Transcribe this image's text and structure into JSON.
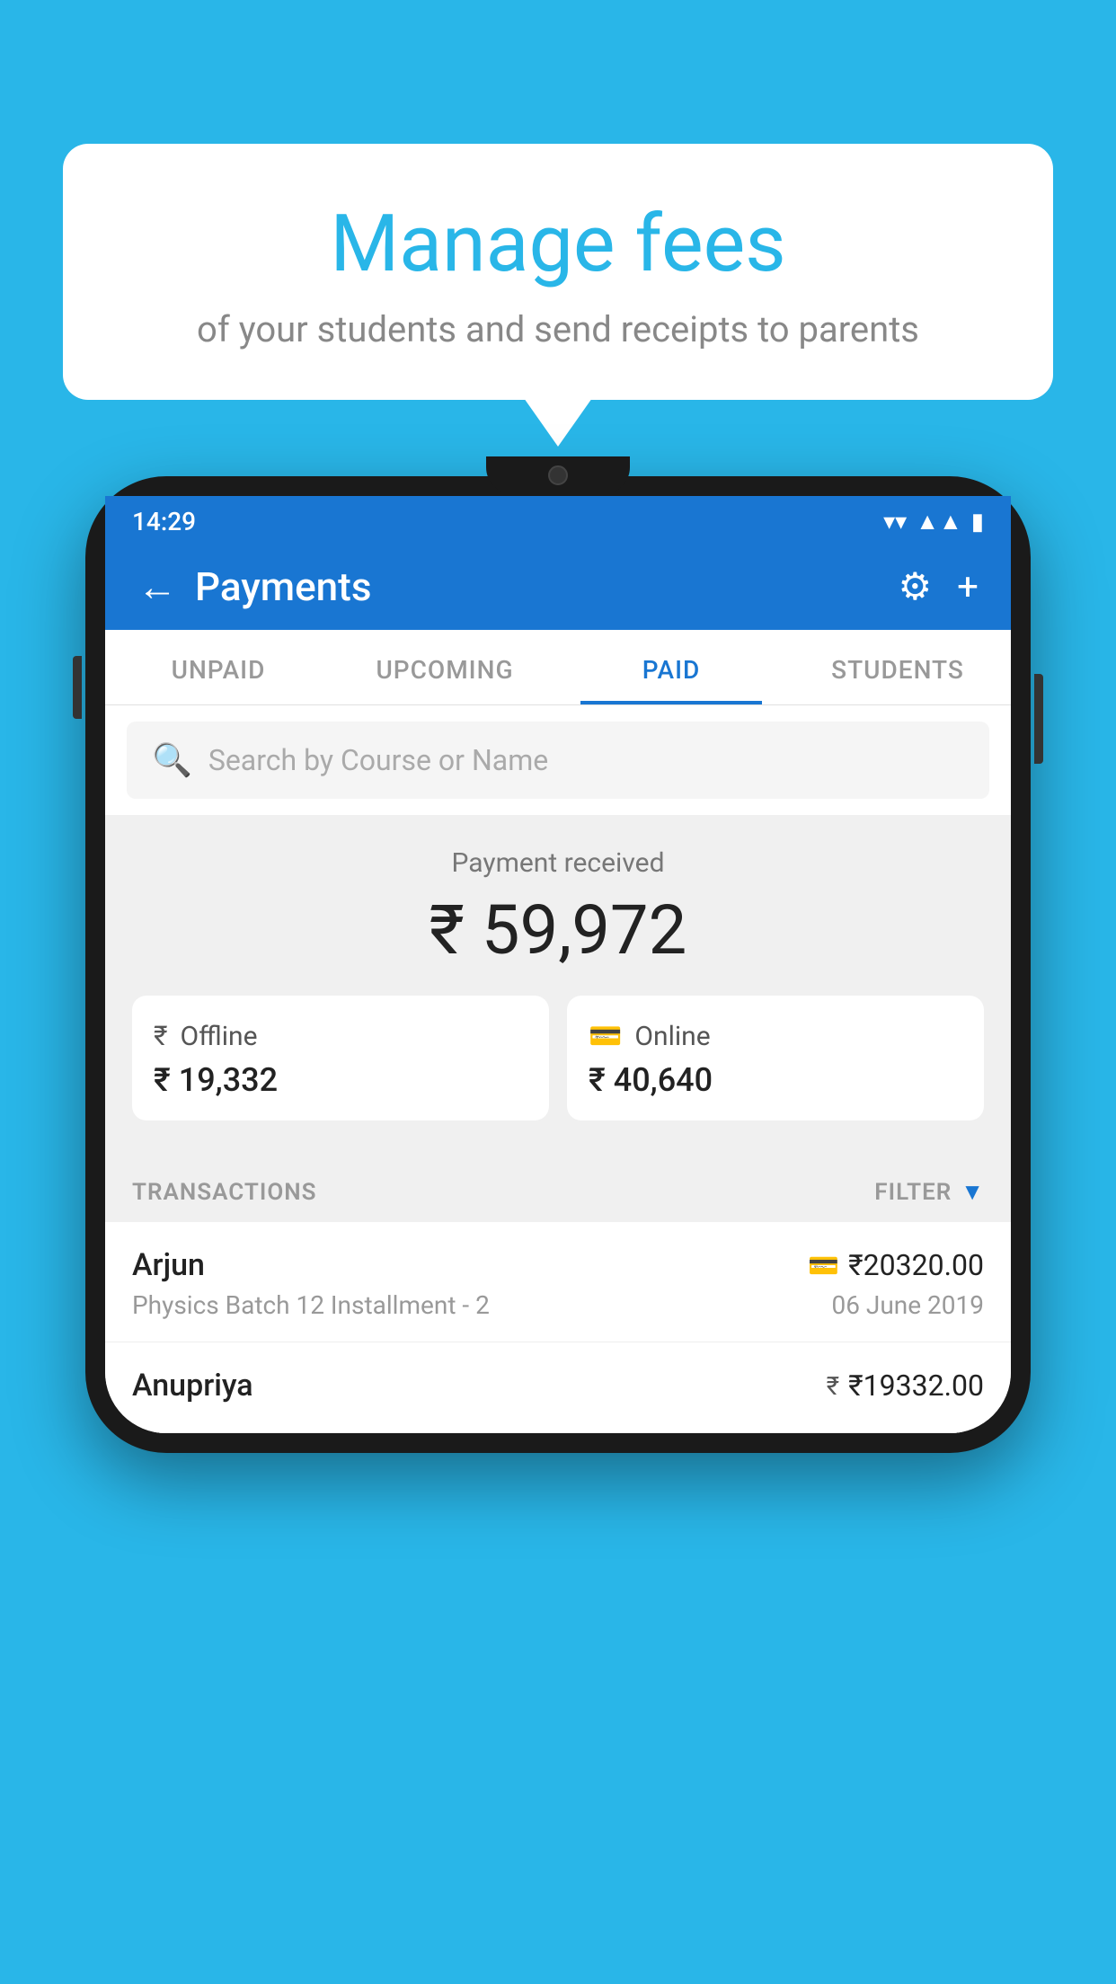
{
  "background_color": "#29b6e8",
  "bubble": {
    "title": "Manage fees",
    "subtitle": "of your students and send receipts to parents"
  },
  "phone": {
    "status_bar": {
      "time": "14:29",
      "wifi": "▼",
      "signal": "▲",
      "battery": "▮"
    },
    "app_bar": {
      "back_label": "←",
      "title": "Payments",
      "gear_label": "⚙",
      "plus_label": "+"
    },
    "tabs": [
      {
        "label": "UNPAID",
        "active": false
      },
      {
        "label": "UPCOMING",
        "active": false
      },
      {
        "label": "PAID",
        "active": true
      },
      {
        "label": "STUDENTS",
        "active": false
      }
    ],
    "search": {
      "placeholder": "Search by Course or Name"
    },
    "payment_summary": {
      "label": "Payment received",
      "amount": "₹ 59,972",
      "offline": {
        "type": "Offline",
        "amount": "₹ 19,332"
      },
      "online": {
        "type": "Online",
        "amount": "₹ 40,640"
      }
    },
    "transactions": {
      "header": "TRANSACTIONS",
      "filter_label": "FILTER",
      "rows": [
        {
          "name": "Arjun",
          "course": "Physics Batch 12 Installment - 2",
          "amount": "₹20320.00",
          "date": "06 June 2019",
          "payment_icon": "card"
        },
        {
          "name": "Anupriya",
          "course": "",
          "amount": "₹19332.00",
          "date": "",
          "payment_icon": "cash"
        }
      ]
    }
  }
}
